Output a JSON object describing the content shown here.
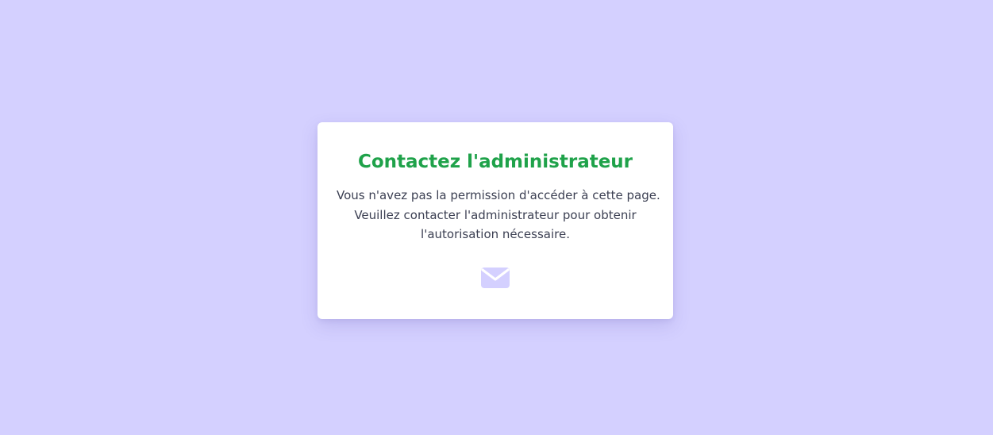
{
  "card": {
    "title": "Contactez l'administrateur",
    "message_lines": [
      "Vous n'avez pas la permission d'accéder à cette page.",
      "Veuillez contacter l'administrateur pour obtenir",
      "l'autorisation nécessaire."
    ],
    "icon": "envelope-icon"
  },
  "colors": {
    "background": "#d4d0ff",
    "card": "#ffffff",
    "title": "#1fa24a",
    "text": "#3b3f52",
    "icon": "#d4d0ff"
  }
}
